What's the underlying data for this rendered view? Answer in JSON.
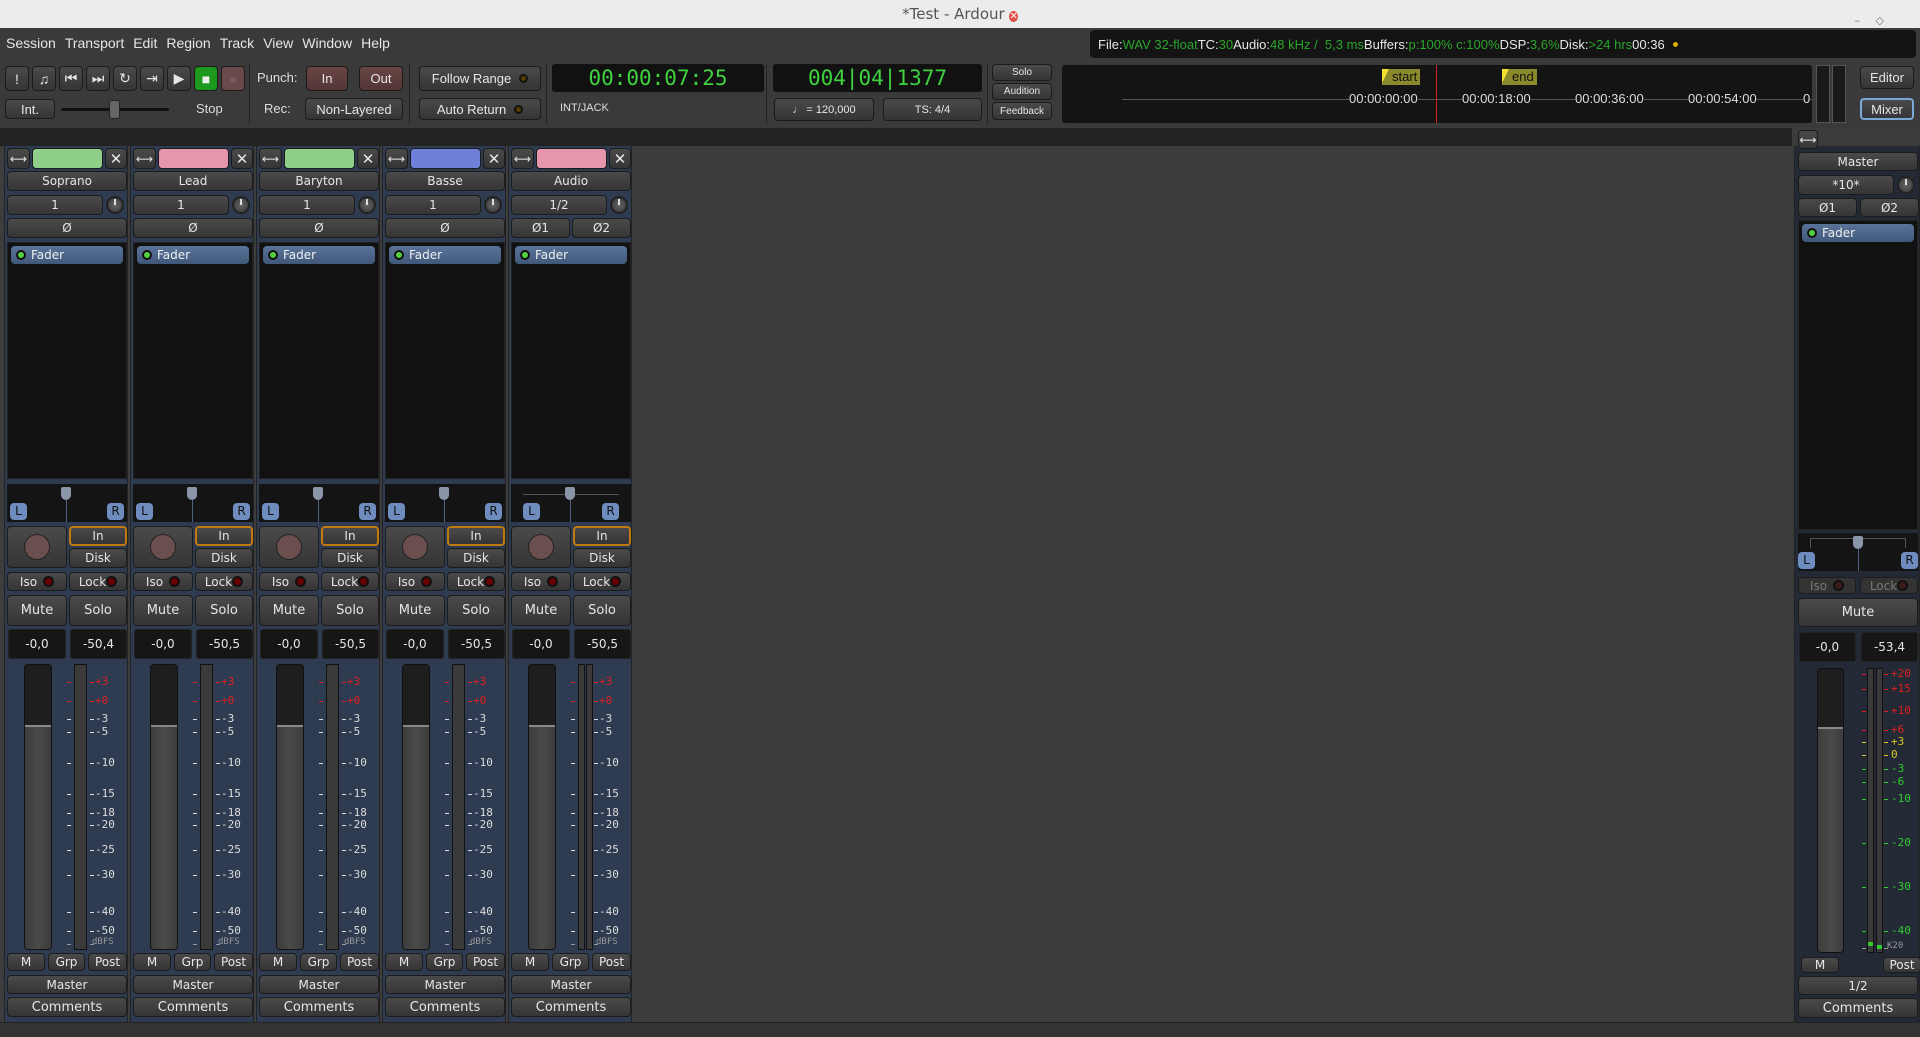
{
  "window": {
    "title": "*Test - Ardour"
  },
  "menu": [
    "Session",
    "Transport",
    "Edit",
    "Region",
    "Track",
    "View",
    "Window",
    "Help"
  ],
  "transport": {
    "icons": [
      "panic-icon",
      "metronome-icon",
      "goto-start-icon",
      "goto-end-icon",
      "loop-icon",
      "play-range-icon",
      "play-icon",
      "stop-icon",
      "record-icon"
    ],
    "int_label": "Int.",
    "stop_label": "Stop",
    "punch_label": "Punch:",
    "punch_in": "In",
    "punch_out": "Out",
    "rec_label": "Rec:",
    "rec_mode": "Non-Layered",
    "follow_range": "Follow Range",
    "auto_return": "Auto Return",
    "timecode": "00:00:07:25",
    "sync_source": "INT/JACK",
    "bbt": "004|04|1377",
    "tempo": "♩ = 120,000",
    "time_signature": "TS: 4/4",
    "solo_label": "Solo",
    "audition_label": "Audition",
    "feedback_label": "Feedback"
  },
  "status": {
    "file_label": "File:",
    "file_value": "WAV 32-float",
    "tc_label": "TC:",
    "tc_value": "30",
    "audio_label": "Audio:",
    "audio_value": "48 kHz /  5,3 ms",
    "buffers_label": "Buffers:",
    "buffers_value": "p:100% c:100%",
    "dsp_label": "DSP:",
    "dsp_value": "3,6%",
    "disk_label": "Disk:",
    "disk_value": ">24 hrs",
    "clock": "00:36"
  },
  "mini_timeline": {
    "markers": [
      "start",
      "end"
    ],
    "ticks": [
      "00:00:00:00",
      "00:00:18:00",
      "00:00:36:00",
      "00:00:54:00",
      "0"
    ]
  },
  "view_buttons": {
    "editor": "Editor",
    "mixer": "Mixer"
  },
  "strips": [
    {
      "name": "Soprano",
      "color": "#8fcf8a",
      "input": "1",
      "phase": [
        "Ø"
      ],
      "processor": "Fader",
      "gain": "-0,0",
      "peak": "-50,4",
      "output": "Master"
    },
    {
      "name": "Lead",
      "color": "#e596ad",
      "input": "1",
      "phase": [
        "Ø"
      ],
      "processor": "Fader",
      "gain": "-0,0",
      "peak": "-50,5",
      "output": "Master"
    },
    {
      "name": "Baryton",
      "color": "#8fcf8a",
      "input": "1",
      "phase": [
        "Ø"
      ],
      "processor": "Fader",
      "gain": "-0,0",
      "peak": "-50,5",
      "output": "Master"
    },
    {
      "name": "Basse",
      "color": "#6e80d8",
      "input": "1",
      "phase": [
        "Ø"
      ],
      "processor": "Fader",
      "gain": "-0,0",
      "peak": "-50,5",
      "output": "Master"
    },
    {
      "name": "Audio",
      "color": "#e596ad",
      "input": "1/2",
      "phase": [
        "Ø1",
        "Ø2"
      ],
      "processor": "Fader",
      "gain": "-0,0",
      "peak": "-50,5",
      "output": "Master"
    }
  ],
  "strip_labels": {
    "in": "In",
    "disk": "Disk",
    "iso": "Iso",
    "lock": "Lock",
    "mute": "Mute",
    "solo": "Solo",
    "m": "M",
    "grp": "Grp",
    "post": "Post",
    "comments": "Comments",
    "pan_l": "L",
    "pan_r": "R"
  },
  "track_meter_scale": [
    "+3",
    "+0",
    "-3",
    "-5",
    "-10",
    "-15",
    "-18",
    "-20",
    "-25",
    "-30",
    "-40",
    "-50",
    "dBFS"
  ],
  "master": {
    "name": "Master",
    "input": "*10*",
    "phase": [
      "Ø1",
      "Ø2"
    ],
    "processor": "Fader",
    "gain": "-0,0",
    "peak": "-53,4",
    "output": "1/2",
    "mute": "Mute",
    "iso": "Iso",
    "lock": "Lock",
    "m": "M",
    "post": "Post",
    "comments": "Comments",
    "meter_scale": [
      "+20",
      "+15",
      "+10",
      "+6",
      "+3",
      "0",
      "-3",
      "-6",
      "-10",
      "-20",
      "-30",
      "-40",
      "K20"
    ]
  },
  "fader_gain_db": 0,
  "colors": {
    "strip_bg": "#2e3b50",
    "clock_green": "#3fd23f",
    "status_green": "#2aa52a",
    "meter_red": "#e02020",
    "meter_yellow": "#d8c820",
    "meter_green": "#2ecc2e"
  }
}
